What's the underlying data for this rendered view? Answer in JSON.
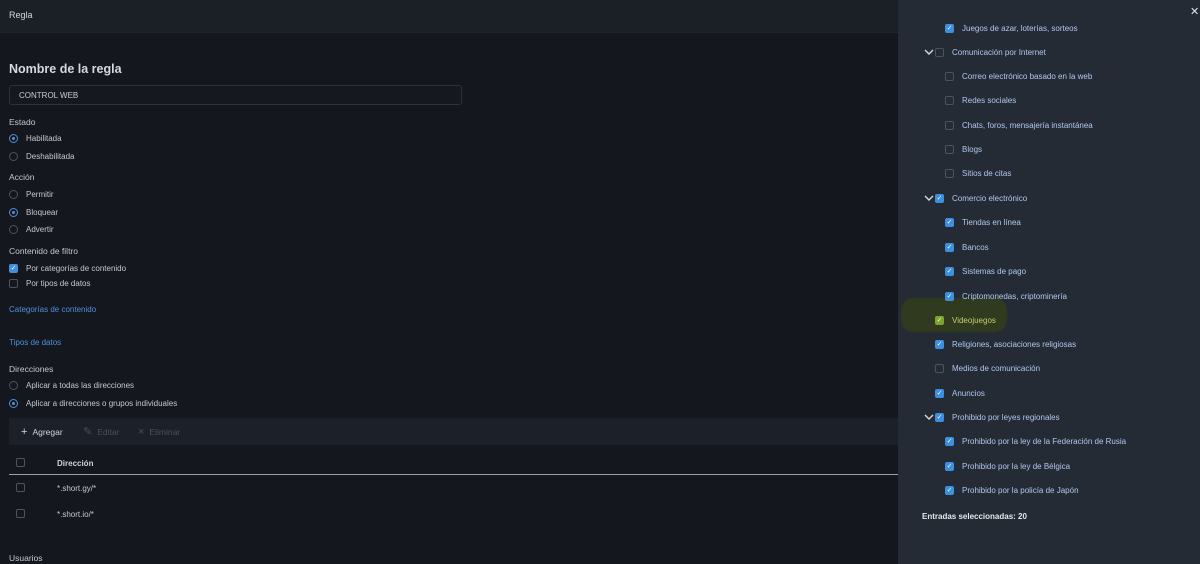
{
  "header": {
    "title": "Regla"
  },
  "form": {
    "heading": "Nombre de la regla",
    "rule_name_value": "CONTROL WEB",
    "estado": {
      "label": "Estado",
      "options": [
        "Habilitada",
        "Deshabilitada"
      ],
      "selected": "Habilitada"
    },
    "accion": {
      "label": "Acción",
      "options": [
        "Permitir",
        "Bloquear",
        "Advertir"
      ],
      "selected": "Bloquear"
    },
    "contenido": {
      "label": "Contenido de filtro",
      "options": [
        {
          "label": "Por categorías de contenido",
          "checked": true
        },
        {
          "label": "Por tipos de datos",
          "checked": false
        }
      ]
    },
    "categorias_link": "Categorías de contenido",
    "tipos_link": "Tipos de datos",
    "direcciones": {
      "label": "Direcciones",
      "options": [
        "Aplicar a todas las direcciones",
        "Aplicar a direcciones o grupos individuales"
      ],
      "selected": "Aplicar a direcciones o grupos individuales"
    },
    "usuarios_label": "Usuarios"
  },
  "toolbar": {
    "add_label": "Agregar",
    "edit_label": "Editar",
    "delete_label": "Eliminar"
  },
  "table": {
    "column": "Dirección",
    "rows": [
      "*.short.gy/*",
      "*.short.io/*"
    ]
  },
  "categories_panel": {
    "items": [
      {
        "label": "Juegos de azar, loterías, sorteos",
        "checked": true,
        "level": 1
      },
      {
        "label": "Comunicación por Internet",
        "checked": false,
        "level": 0,
        "expanded": true
      },
      {
        "label": "Correo electrónico basado en la web",
        "checked": false,
        "level": 1
      },
      {
        "label": "Redes sociales",
        "checked": false,
        "level": 1
      },
      {
        "label": "Chats, foros, mensajería instantánea",
        "checked": false,
        "level": 1
      },
      {
        "label": "Blogs",
        "checked": false,
        "level": 1
      },
      {
        "label": "Sitios de citas",
        "checked": false,
        "level": 1
      },
      {
        "label": "Comercio electrónico",
        "checked": true,
        "level": 0,
        "expanded": true
      },
      {
        "label": "Tiendas en línea",
        "checked": true,
        "level": 1
      },
      {
        "label": "Bancos",
        "checked": true,
        "level": 1
      },
      {
        "label": "Sistemas de pago",
        "checked": true,
        "level": 1
      },
      {
        "label": "Criptomonedas, criptominería",
        "checked": true,
        "level": 1
      },
      {
        "label": "Videojuegos",
        "checked": true,
        "level": 0,
        "highlighted": true
      },
      {
        "label": "Religiones, asociaciones religiosas",
        "checked": true,
        "level": 0
      },
      {
        "label": "Medios de comunicación",
        "checked": false,
        "level": 0
      },
      {
        "label": "Anuncios",
        "checked": true,
        "level": 0
      },
      {
        "label": "Prohibido por leyes regionales",
        "checked": true,
        "level": 0,
        "expanded": true
      },
      {
        "label": "Prohibido por la ley de la Federación de Rusia",
        "checked": true,
        "level": 1
      },
      {
        "label": "Prohibido por la ley de Bélgica",
        "checked": true,
        "level": 1
      },
      {
        "label": "Prohibido por la policía de Japón",
        "checked": true,
        "level": 1
      }
    ],
    "selected_count_text": "Entradas seleccionadas: 20"
  },
  "colors": {
    "accent": "#3d8fe0",
    "highlight": "#7ea52a",
    "panel_bg": "#252b35",
    "main_bg": "#14171d"
  },
  "icons": {
    "close": "close-icon",
    "add": "plus-icon",
    "edit": "pencil-icon",
    "delete": "x-icon",
    "expand": "chevron-down-icon"
  }
}
